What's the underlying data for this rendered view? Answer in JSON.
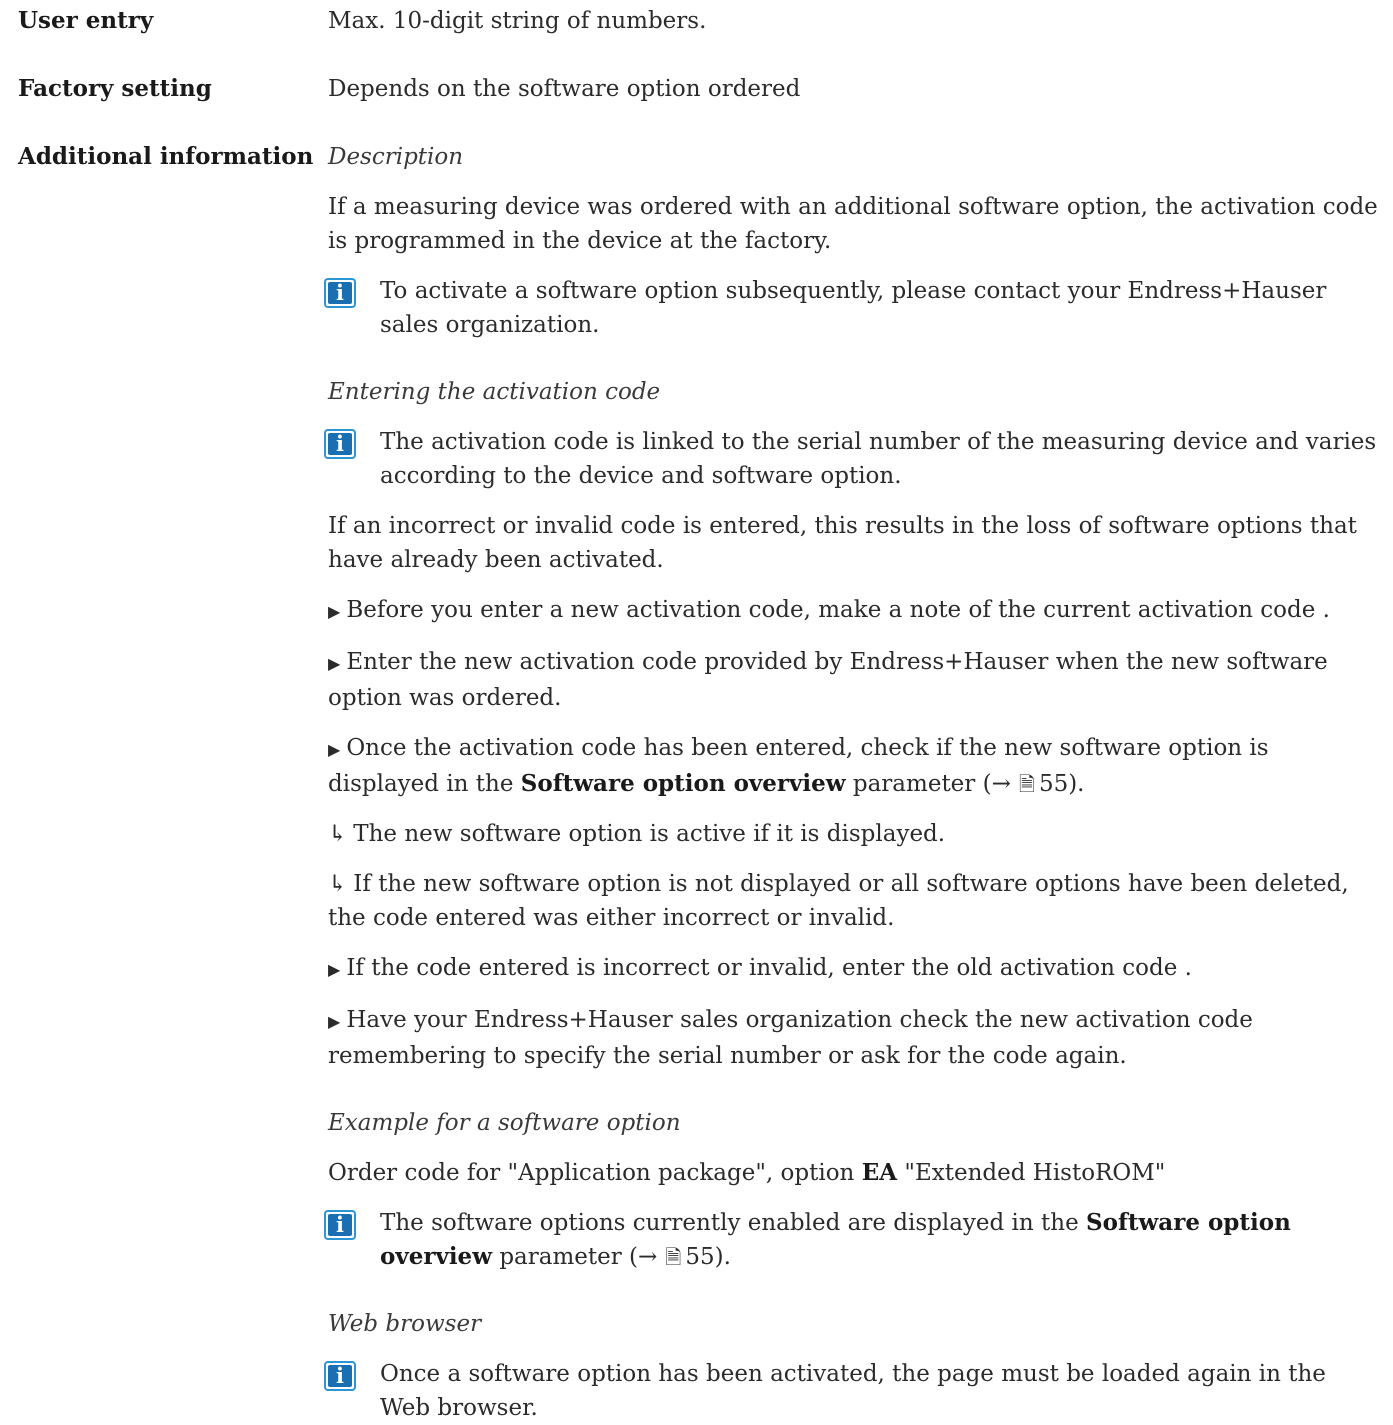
{
  "rows": {
    "user_entry": {
      "label": "User entry",
      "value": "Max. 10-digit string of numbers."
    },
    "factory_setting": {
      "label": "Factory setting",
      "value": "Depends on the software option ordered"
    },
    "additional_info": {
      "label": "Additional information"
    }
  },
  "sections": {
    "description": {
      "heading": "Description",
      "para": "If a measuring device was ordered with an additional software option, the activation code is programmed in the device at the factory.",
      "note": "To activate a software option subsequently, please contact your Endress+Hauser sales organization."
    },
    "entering": {
      "heading": "Entering the activation code",
      "note": "The activation code is linked to the serial number of the measuring device and varies according to the device and software option.",
      "para": "If an incorrect or invalid code is entered, this results in the loss of software options that have already been activated.",
      "step1": "Before you enter a new activation code, make a note of the current activation code .",
      "step2": "Enter the new activation code provided by Endress+Hauser when the new software option was ordered.",
      "step3_pre": "Once the activation code has been entered, check if the new software option is displayed in the",
      "step3_bold": "Software option overview",
      "step3_post": "parameter (→",
      "step3_page": "55).",
      "result1": "The new software option is active if it is displayed.",
      "result2": "If the new software option is not displayed or all software options have been deleted, the code entered was either incorrect or invalid.",
      "step4": "If the code entered is incorrect or invalid, enter the old activation code .",
      "step5": "Have your Endress+Hauser sales organization check the new activation code remembering to specify the serial number or ask for the code again."
    },
    "example": {
      "heading": "Example for a software option",
      "para_pre": "Order code for \"Application package\", option",
      "para_bold": "EA",
      "para_post": "\"Extended HistoROM\"",
      "note_pre": "The software options currently enabled are displayed in the",
      "note_bold": "Software option overview",
      "note_post": "parameter (→",
      "note_page": "55)."
    },
    "web": {
      "heading": "Web browser",
      "note": "Once a software option has been activated, the page must be loaded again in the Web browser."
    }
  },
  "icons": {
    "info": "i",
    "bullet": "▶",
    "result": "↳",
    "page_ref": "📄"
  }
}
